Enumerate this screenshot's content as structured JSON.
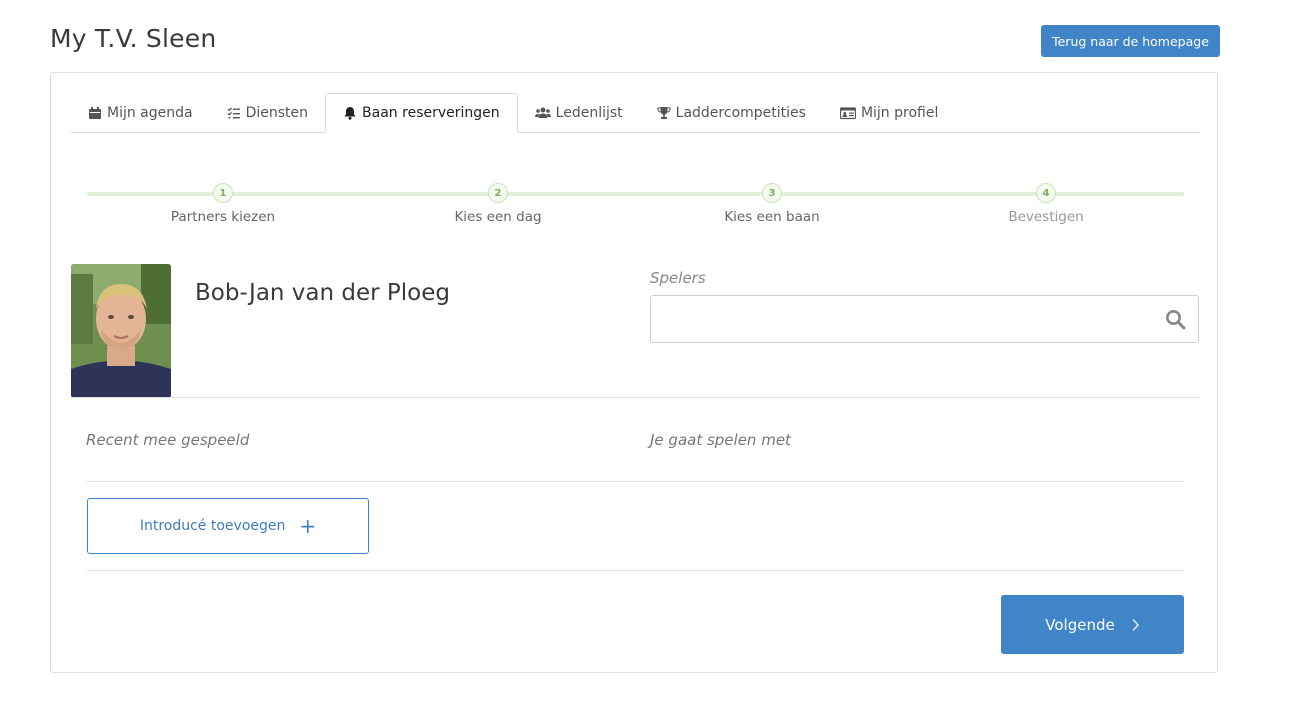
{
  "header": {
    "title": "My T.V. Sleen",
    "home_button": "Terug naar de homepage"
  },
  "tabs": [
    {
      "label": "Mijn agenda",
      "icon": "calendar-icon",
      "active": false
    },
    {
      "label": "Diensten",
      "icon": "checklist-icon",
      "active": false
    },
    {
      "label": "Baan reserveringen",
      "icon": "bell-icon",
      "active": true
    },
    {
      "label": "Ledenlijst",
      "icon": "users-icon",
      "active": false
    },
    {
      "label": "Laddercompetities",
      "icon": "trophy-icon",
      "active": false
    },
    {
      "label": "Mijn profiel",
      "icon": "id-card-icon",
      "active": false
    }
  ],
  "steps": [
    {
      "number": "1",
      "label": "Partners kiezen"
    },
    {
      "number": "2",
      "label": "Kies een dag"
    },
    {
      "number": "3",
      "label": "Kies een baan"
    },
    {
      "number": "4",
      "label": "Bevestigen"
    }
  ],
  "player": {
    "name": "Bob-Jan van der Ploeg"
  },
  "search": {
    "label": "Spelers",
    "value": "",
    "icon": "search-icon"
  },
  "sections": {
    "recent": "Recent mee gespeeld",
    "playing_with": "Je gaat spelen met"
  },
  "buttons": {
    "add_intro": "Introducé toevoegen",
    "next": "Volgende"
  },
  "colors": {
    "accent": "#3f85c8",
    "step_green": "#7cb35a",
    "step_track": "#e2efd9"
  }
}
